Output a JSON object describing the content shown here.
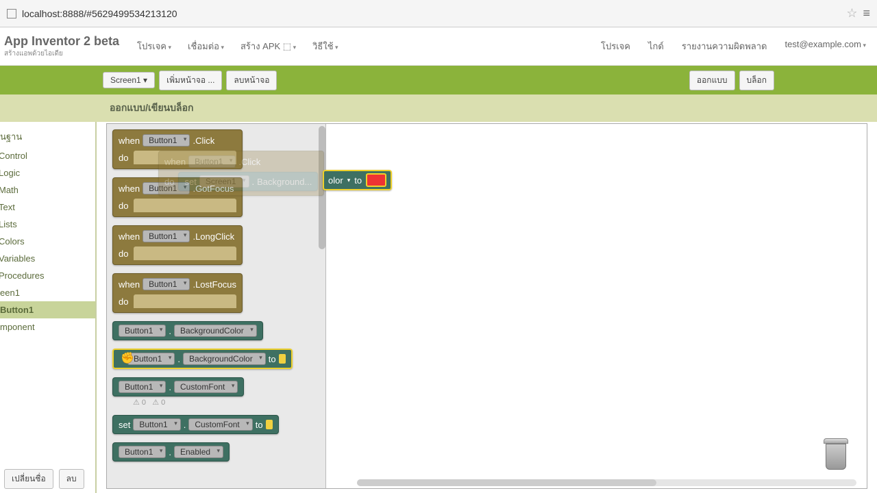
{
  "url": "localhost:8888/#5629499534213120",
  "brand": {
    "title": "App Inventor 2 beta",
    "sub": "สร้างแอพด้วยไอเดีย"
  },
  "nav": {
    "projects": "โปรเจค",
    "connect": "เชื่อมต่อ",
    "build": "สร้าง APK",
    "help": "วิธีใช้"
  },
  "nav_right": {
    "projects": "โปรเจค",
    "guide": "ไกด์",
    "report": "รายงานความผิดพลาด",
    "user": "test@example.com"
  },
  "greenbar": {
    "screen": "Screen1",
    "add": "เพิ่มหน้าจอ ...",
    "remove": "ลบหน้าจอ",
    "designer": "ออกแบบ",
    "blocks": "บล็อก"
  },
  "designbar": {
    "label": "ออกแบบ/เขียนบล็อก"
  },
  "left": {
    "builtin": "นฐาน",
    "control": "Control",
    "logic": "Logic",
    "math": "Math",
    "text": "Text",
    "lists": "Lists",
    "colors": "Colors",
    "variables": "Variables",
    "procedures": "Procedures",
    "screen1": "een1",
    "button1": "Button1",
    "anycomp": "mponent"
  },
  "blocks": {
    "when": "when",
    "do": "do",
    "set": "set",
    "to": "to",
    "button1": "Button1",
    "screen1": "Screen1",
    "click": ".Click",
    "gotfocus": ".GotFocus",
    "longclick": ".LongClick",
    "lostfocus": ".LostFocus",
    "bgcolor": "BackgroundColor",
    "bgcolor_canvas": "BackgroundColor",
    "bgfrag": "olor",
    "customfont": "CustomFont",
    "enabled": "Enabled",
    "dot": "."
  },
  "status": {
    "warn1": "0",
    "warn2": "0"
  },
  "bottom": {
    "rename": "เปลี่ยนชื่อ",
    "delete": "ลบ"
  }
}
